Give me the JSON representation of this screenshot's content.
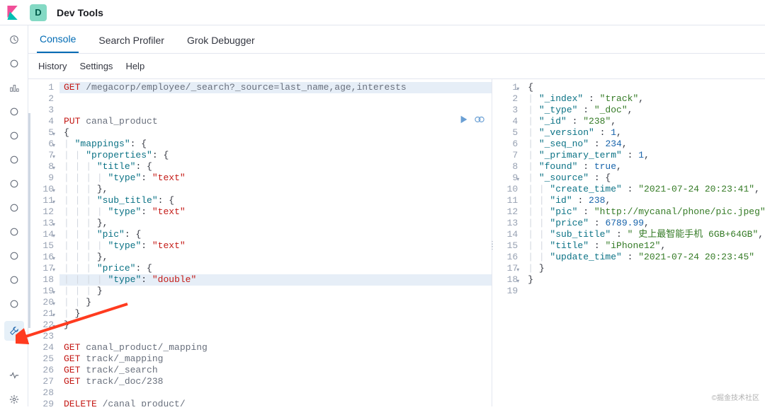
{
  "header": {
    "badge_letter": "D",
    "title": "Dev Tools"
  },
  "tabs": [
    {
      "label": "Console",
      "selected": true
    },
    {
      "label": "Search Profiler",
      "selected": false
    },
    {
      "label": "Grok Debugger",
      "selected": false
    }
  ],
  "subtabs": [
    "History",
    "Settings",
    "Help"
  ],
  "sidebar_icons": [
    "clock-icon",
    "compass-icon",
    "bar-chart-icon",
    "metric-icon",
    "dashboard-icon",
    "location-icon",
    "graph-icon",
    "user-icon",
    "tool-icon",
    "link-icon",
    "rotate-icon",
    "rss-icon",
    "wrench-icon",
    "heartbeat-icon",
    "gear-icon"
  ],
  "active_sidebar_index": 12,
  "request_editor": {
    "lines": [
      [
        {
          "m": "GET"
        },
        {
          "t": " "
        },
        {
          "u": "/megacorp/employee/_search?_source=last_name,age,interests"
        }
      ],
      [],
      [],
      [
        {
          "m": "PUT"
        },
        {
          "t": " "
        },
        {
          "u": "canal_product"
        }
      ],
      [
        {
          "p": "{"
        }
      ],
      [
        {
          "t": "  "
        },
        {
          "k": "\"mappings\""
        },
        {
          "p": ": {"
        }
      ],
      [
        {
          "t": "    "
        },
        {
          "k": "\"properties\""
        },
        {
          "p": ": {"
        }
      ],
      [
        {
          "t": "      "
        },
        {
          "k": "\"title\""
        },
        {
          "p": ": {"
        }
      ],
      [
        {
          "t": "        "
        },
        {
          "k": "\"type\""
        },
        {
          "p": ": "
        },
        {
          "s": "\"text\""
        }
      ],
      [
        {
          "t": "      "
        },
        {
          "p": "},"
        }
      ],
      [
        {
          "t": "      "
        },
        {
          "k": "\"sub_title\""
        },
        {
          "p": ": {"
        }
      ],
      [
        {
          "t": "        "
        },
        {
          "k": "\"type\""
        },
        {
          "p": ": "
        },
        {
          "s": "\"text\""
        }
      ],
      [
        {
          "t": "      "
        },
        {
          "p": "},"
        }
      ],
      [
        {
          "t": "      "
        },
        {
          "k": "\"pic\""
        },
        {
          "p": ": {"
        }
      ],
      [
        {
          "t": "        "
        },
        {
          "k": "\"type\""
        },
        {
          "p": ": "
        },
        {
          "s": "\"text\""
        }
      ],
      [
        {
          "t": "      "
        },
        {
          "p": "},"
        }
      ],
      [
        {
          "t": "      "
        },
        {
          "k": "\"price\""
        },
        {
          "p": ": {"
        }
      ],
      [
        {
          "t": "        "
        },
        {
          "k": "\"type\""
        },
        {
          "p": ": "
        },
        {
          "s": "\"double\""
        }
      ],
      [
        {
          "t": "      "
        },
        {
          "p": "}"
        }
      ],
      [
        {
          "t": "    "
        },
        {
          "p": "}"
        }
      ],
      [
        {
          "t": "  "
        },
        {
          "p": "}"
        }
      ],
      [
        {
          "p": "}"
        }
      ],
      [],
      [
        {
          "m": "GET"
        },
        {
          "t": " "
        },
        {
          "u": "canal_product/_mapping"
        }
      ],
      [
        {
          "m": "GET"
        },
        {
          "t": " "
        },
        {
          "u": "track/_mapping"
        }
      ],
      [
        {
          "m": "GET"
        },
        {
          "t": " "
        },
        {
          "u": "track/_search"
        }
      ],
      [
        {
          "m": "GET"
        },
        {
          "t": " "
        },
        {
          "u": "track/_doc/238"
        }
      ],
      [],
      [
        {
          "m": "DELETE"
        },
        {
          "t": " "
        },
        {
          "u": "/canal_product/"
        }
      ]
    ],
    "fold_lines": [
      5,
      6,
      7,
      8,
      10,
      11,
      13,
      14,
      16,
      17,
      19,
      20,
      21,
      22
    ],
    "highlight_first_line": true,
    "highlight_line_18": true
  },
  "response_editor": {
    "lines": [
      [
        {
          "p": "{"
        }
      ],
      [
        {
          "t": "  "
        },
        {
          "k": "\"_index\""
        },
        {
          "p": " : "
        },
        {
          "s2": "\"track\""
        },
        {
          "p": ","
        }
      ],
      [
        {
          "t": "  "
        },
        {
          "k": "\"_type\""
        },
        {
          "p": " : "
        },
        {
          "s2": "\"_doc\""
        },
        {
          "p": ","
        }
      ],
      [
        {
          "t": "  "
        },
        {
          "k": "\"_id\""
        },
        {
          "p": " : "
        },
        {
          "s2": "\"238\""
        },
        {
          "p": ","
        }
      ],
      [
        {
          "t": "  "
        },
        {
          "k": "\"_version\""
        },
        {
          "p": " : "
        },
        {
          "n": "1"
        },
        {
          "p": ","
        }
      ],
      [
        {
          "t": "  "
        },
        {
          "k": "\"_seq_no\""
        },
        {
          "p": " : "
        },
        {
          "n": "234"
        },
        {
          "p": ","
        }
      ],
      [
        {
          "t": "  "
        },
        {
          "k": "\"_primary_term\""
        },
        {
          "p": " : "
        },
        {
          "n": "1"
        },
        {
          "p": ","
        }
      ],
      [
        {
          "t": "  "
        },
        {
          "k": "\"found\""
        },
        {
          "p": " : "
        },
        {
          "b": "true"
        },
        {
          "p": ","
        }
      ],
      [
        {
          "t": "  "
        },
        {
          "k": "\"_source\""
        },
        {
          "p": " : {"
        }
      ],
      [
        {
          "t": "    "
        },
        {
          "k": "\"create_time\""
        },
        {
          "p": " : "
        },
        {
          "s2": "\"2021-07-24 20:23:41\""
        },
        {
          "p": ","
        }
      ],
      [
        {
          "t": "    "
        },
        {
          "k": "\"id\""
        },
        {
          "p": " : "
        },
        {
          "n": "238"
        },
        {
          "p": ","
        }
      ],
      [
        {
          "t": "    "
        },
        {
          "k": "\"pic\""
        },
        {
          "p": " : "
        },
        {
          "s2": "\"http://mycanal/phone/pic.jpeg\""
        },
        {
          "p": ","
        }
      ],
      [
        {
          "t": "    "
        },
        {
          "k": "\"price\""
        },
        {
          "p": " : "
        },
        {
          "n": "6789.99"
        },
        {
          "p": ","
        }
      ],
      [
        {
          "t": "    "
        },
        {
          "k": "\"sub_title\""
        },
        {
          "p": " : "
        },
        {
          "s2": "\" 史上最智能手机 6GB+64GB\""
        },
        {
          "p": ","
        }
      ],
      [
        {
          "t": "    "
        },
        {
          "k": "\"title\""
        },
        {
          "p": " : "
        },
        {
          "s2": "\"iPhone12\""
        },
        {
          "p": ","
        }
      ],
      [
        {
          "t": "    "
        },
        {
          "k": "\"update_time\""
        },
        {
          "p": " : "
        },
        {
          "s2": "\"2021-07-24 20:23:45\""
        }
      ],
      [
        {
          "t": "  "
        },
        {
          "p": "}"
        }
      ],
      [
        {
          "p": "}"
        }
      ],
      []
    ],
    "fold_lines": [
      1,
      9,
      17,
      18
    ]
  },
  "watermark": "©掘金技术社区"
}
